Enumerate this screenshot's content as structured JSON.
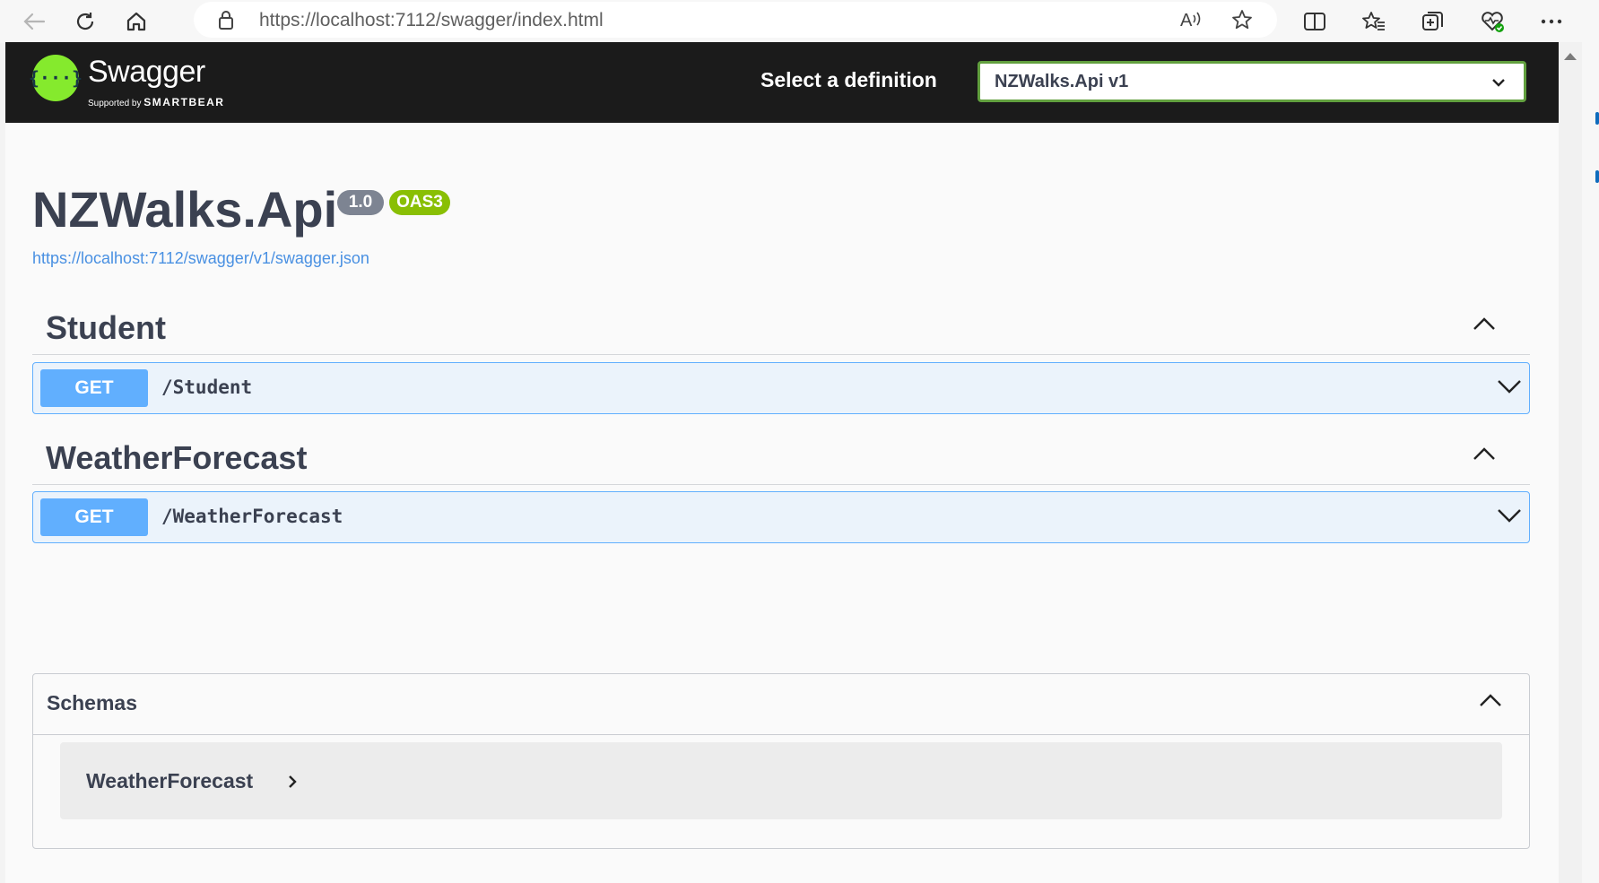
{
  "browser": {
    "url": "https://localhost:7112/swagger/index.html",
    "icons": [
      "back-icon",
      "refresh-icon",
      "home-icon",
      "lock-icon",
      "read-aloud-icon",
      "favorite-star-icon",
      "split-screen-icon",
      "favorites-icon",
      "collections-icon",
      "browser-essentials-icon",
      "more-icon"
    ]
  },
  "topbar": {
    "brand": "Swagger",
    "supported_by": "Supported by",
    "smartbear": "SMARTBEAR",
    "definition_label": "Select a definition",
    "definition_value": "NZWalks.Api v1"
  },
  "info": {
    "title": "NZWalks.Api",
    "version": "1.0",
    "oas": "OAS3",
    "spec_url": "https://localhost:7112/swagger/v1/swagger.json"
  },
  "tags": [
    {
      "name": "Student",
      "operations": [
        {
          "method": "GET",
          "path": "/Student"
        }
      ]
    },
    {
      "name": "WeatherForecast",
      "operations": [
        {
          "method": "GET",
          "path": "/WeatherForecast"
        }
      ]
    }
  ],
  "schemas": {
    "title": "Schemas",
    "models": [
      "WeatherForecast"
    ]
  },
  "colors": {
    "topbar_bg": "#1b1b1b",
    "swagger_green": "#85ea2d",
    "get_blue": "#61affe",
    "get_bg": "#ebf3fb",
    "oas_badge": "#89bf04",
    "version_badge": "#7d8492"
  }
}
